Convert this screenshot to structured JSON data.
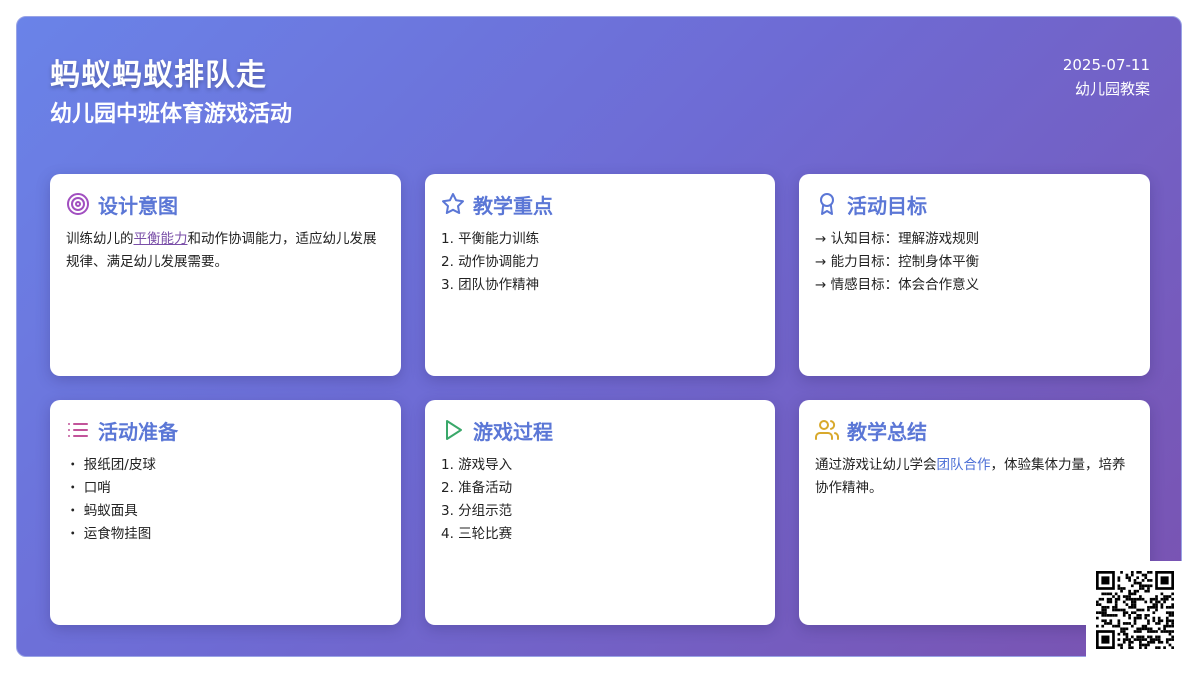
{
  "header": {
    "title": "蚂蚁蚂蚁排队走",
    "subtitle": "幼儿园中班体育游戏活动",
    "date": "2025-07-11",
    "doc_type": "幼儿园教案"
  },
  "cards": [
    {
      "title": "设计意图",
      "icon": "target-icon",
      "text_pre": "训练幼儿的",
      "highlight": "平衡能力",
      "text_post": "和动作协调能力，适应幼儿发展规律、满足幼儿发展需要。"
    },
    {
      "title": "教学重点",
      "icon": "star-icon",
      "items": [
        "1. 平衡能力训练",
        "2. 动作协调能力",
        "3. 团队协作精神"
      ]
    },
    {
      "title": "活动目标",
      "icon": "award-icon",
      "items": [
        "→ 认知目标：理解游戏规则",
        "→ 能力目标：控制身体平衡",
        "→ 情感目标：体会合作意义"
      ]
    },
    {
      "title": "活动准备",
      "icon": "list-icon",
      "items": [
        "・ 报纸团/皮球",
        "・ 口哨",
        "・ 蚂蚁面具",
        "・ 运食物挂图"
      ]
    },
    {
      "title": "游戏过程",
      "icon": "play-icon",
      "items": [
        "1. 游戏导入",
        "2. 准备活动",
        "3. 分组示范",
        "4. 三轮比赛"
      ]
    },
    {
      "title": "教学总结",
      "icon": "users-icon",
      "text_pre": "通过游戏让幼儿学会",
      "highlight": "团队合作",
      "text_post": "，体验集体力量，培养协作精神。"
    }
  ],
  "colors": {
    "gradient_start": "#6a83e8",
    "gradient_end": "#7a52b0",
    "card_title": "#5b77d6",
    "icon_purple": "#a14fc0",
    "icon_blue": "#5b77d6",
    "icon_pink": "#c2549a",
    "icon_green": "#3aa86a",
    "icon_gold": "#d8a92c"
  }
}
